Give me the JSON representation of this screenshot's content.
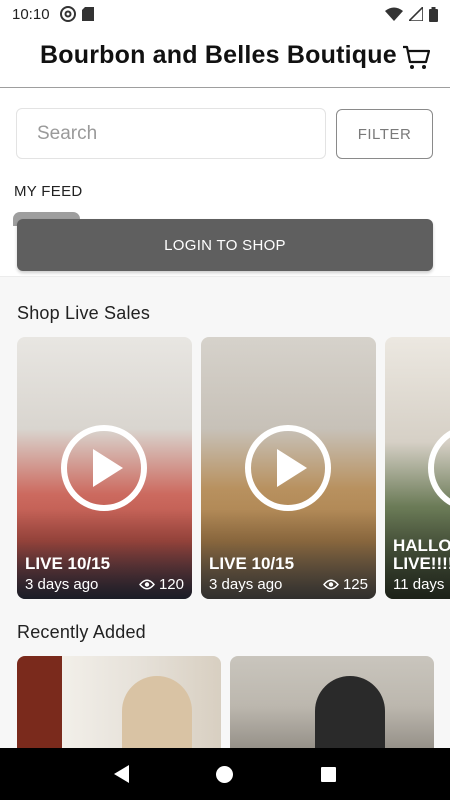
{
  "status_bar": {
    "time": "10:10",
    "left_icons": [
      "at-sign-icon",
      "sd-card-icon"
    ],
    "right_icons": [
      "wifi-icon",
      "cell-signal-icon",
      "battery-icon"
    ]
  },
  "header": {
    "title": "Bourbon and Belles Boutique",
    "cart_icon": "cart-icon"
  },
  "search": {
    "placeholder": "Search",
    "value": "",
    "filter_label": "FILTER"
  },
  "feed": {
    "label": "MY FEED"
  },
  "login": {
    "label": "LOGIN TO SHOP"
  },
  "live_sales": {
    "title": "Shop Live Sales",
    "cards": [
      {
        "title": "LIVE 10/15",
        "age": "3 days ago",
        "views": "120"
      },
      {
        "title": "LIVE 10/15",
        "age": "3 days ago",
        "views": "125"
      },
      {
        "title": "HALLO LIVE!!!!",
        "age": "11 days",
        "views": ""
      }
    ]
  },
  "recently_added": {
    "title": "Recently Added"
  },
  "colors": {
    "accent_dark": "#5f5f5f",
    "divider": "#9e9e9e",
    "nav_background": "#000000"
  }
}
